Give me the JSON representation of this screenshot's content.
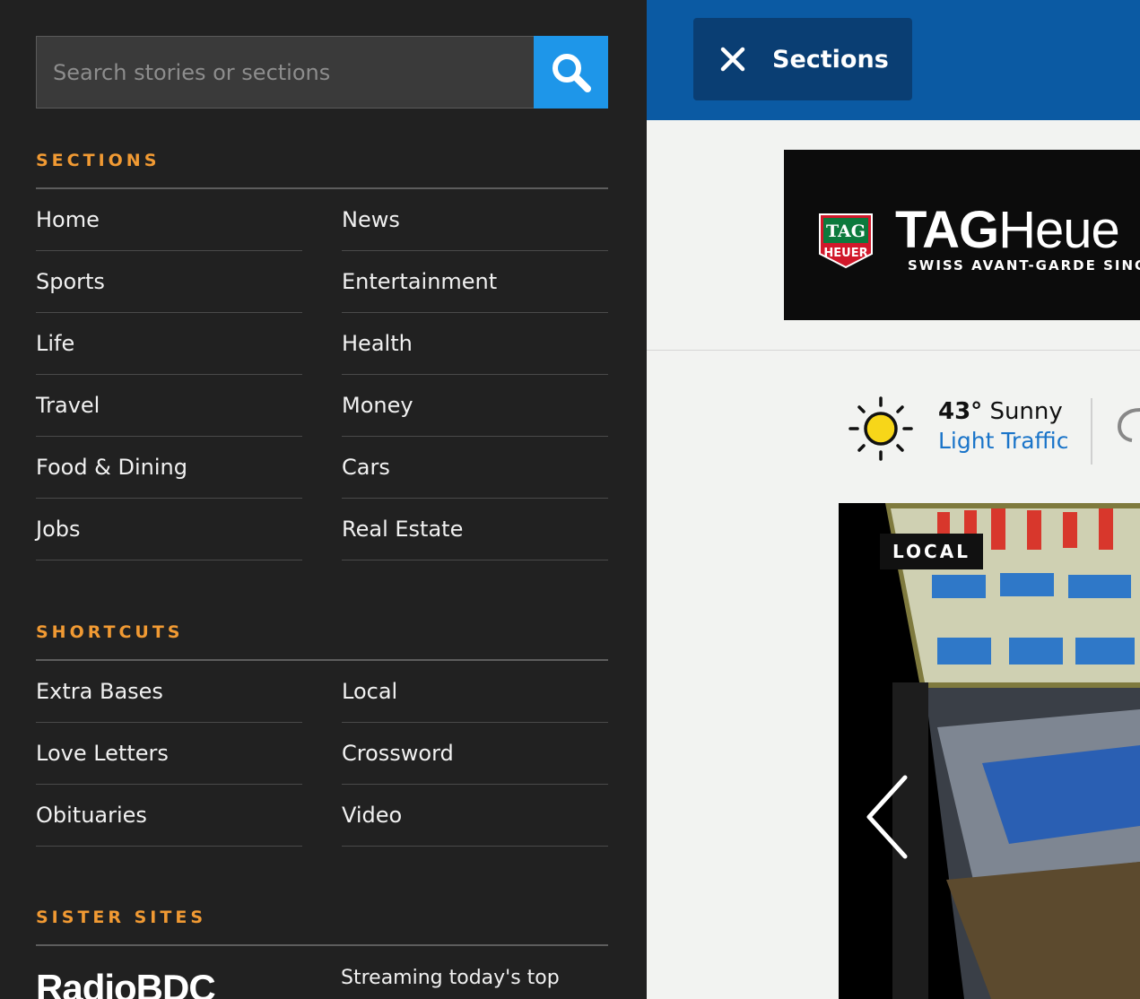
{
  "drawer": {
    "search": {
      "placeholder": "Search stories or sections",
      "button_icon": "search-icon"
    },
    "sections": {
      "heading": "SECTIONS",
      "items": [
        {
          "label": "Home"
        },
        {
          "label": "News"
        },
        {
          "label": "Sports"
        },
        {
          "label": "Entertainment"
        },
        {
          "label": "Life"
        },
        {
          "label": "Health"
        },
        {
          "label": "Travel"
        },
        {
          "label": "Money"
        },
        {
          "label": "Food & Dining"
        },
        {
          "label": "Cars"
        },
        {
          "label": "Jobs"
        },
        {
          "label": "Real Estate"
        }
      ]
    },
    "shortcuts": {
      "heading": "SHORTCUTS",
      "items": [
        {
          "label": "Extra Bases"
        },
        {
          "label": "Local"
        },
        {
          "label": "Love Letters"
        },
        {
          "label": "Crossword"
        },
        {
          "label": "Obituaries"
        },
        {
          "label": "Video"
        }
      ]
    },
    "sister_sites": {
      "heading": "SISTER SITES",
      "logo_text": "RadioBDC",
      "description": "Streaming today's top"
    }
  },
  "header": {
    "close_icon": "close-icon",
    "sections_label": "Sections"
  },
  "ad": {
    "badge_text_top": "TAG",
    "badge_text_bottom": "HEUER",
    "brand_bold": "TAG",
    "brand_light": "Heue",
    "tagline": "SWISS AVANT-GARDE SINCE"
  },
  "weather": {
    "icon": "sun-icon",
    "temp": "43°",
    "condition": "Sunny",
    "traffic": "Light Traffic"
  },
  "story": {
    "label": "LOCAL",
    "prev_icon": "chevron-left-icon"
  },
  "colors": {
    "drawer_bg": "#212121",
    "accent": "#f19a33",
    "search_button": "#1e96e9",
    "header_bg": "#0b5aa3",
    "close_button_bg": "#0a3e73",
    "link": "#1a74c9"
  }
}
